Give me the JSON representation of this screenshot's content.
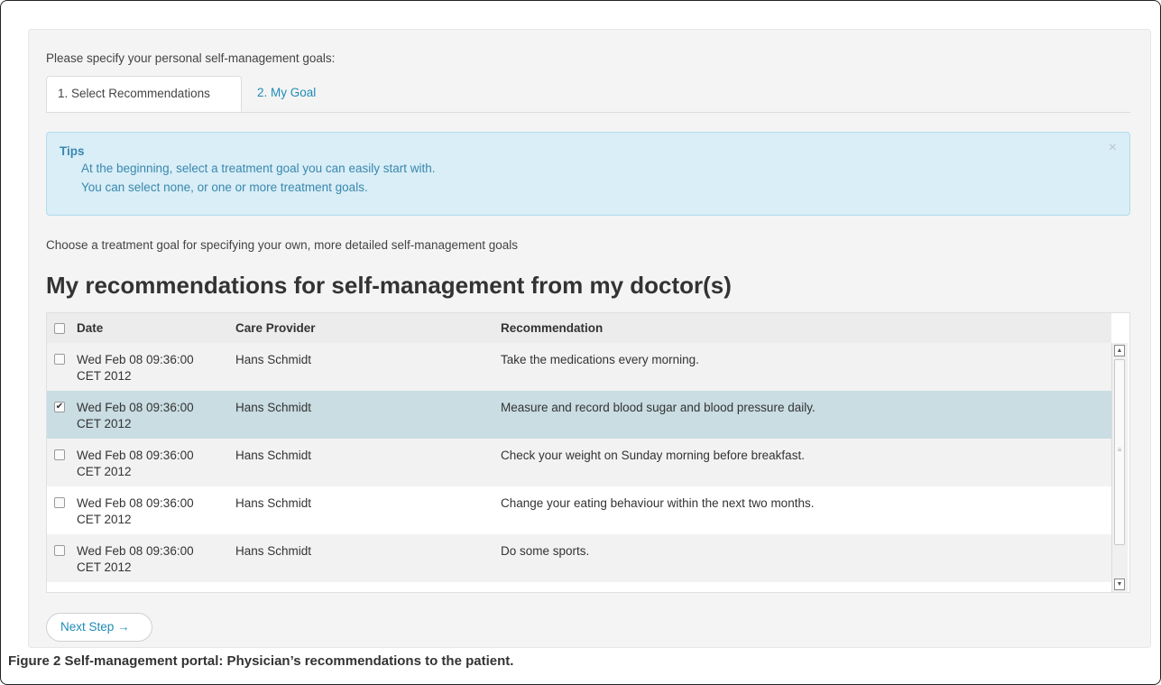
{
  "intro_text": "Please specify your personal self-management goals:",
  "tabs": [
    {
      "label": "1. Select Recommendations",
      "active": true
    },
    {
      "label": "2. My Goal",
      "active": false
    }
  ],
  "tips": {
    "title": "Tips",
    "lines": [
      "At the beginning, select a treatment goal you can easily start with.",
      "You can select none, or one or more treatment goals."
    ],
    "close_glyph": "×"
  },
  "choose_text": "Choose a treatment goal for specifying your own, more detailed self-management goals",
  "heading": "My recommendations for self-management from my doctor(s)",
  "table": {
    "columns": [
      "Date",
      "Care Provider",
      "Recommendation"
    ],
    "rows": [
      {
        "date_line1": "Wed Feb 08 09:36:00",
        "date_line2": "CET 2012",
        "provider": "Hans Schmidt",
        "recommendation": "Take the medications every morning.",
        "checked": false
      },
      {
        "date_line1": "Wed Feb 08 09:36:00",
        "date_line2": "CET 2012",
        "provider": "Hans Schmidt",
        "recommendation": "Measure and record blood sugar and blood pressure daily.",
        "checked": true
      },
      {
        "date_line1": "Wed Feb 08 09:36:00",
        "date_line2": "CET 2012",
        "provider": "Hans Schmidt",
        "recommendation": "Check your weight on Sunday morning before breakfast.",
        "checked": false
      },
      {
        "date_line1": "Wed Feb 08 09:36:00",
        "date_line2": "CET 2012",
        "provider": "Hans Schmidt",
        "recommendation": "Change your eating behaviour within the next two months.",
        "checked": false
      },
      {
        "date_line1": "Wed Feb 08 09:36:00",
        "date_line2": "CET 2012",
        "provider": "Hans Schmidt",
        "recommendation": "Do some sports.",
        "checked": false
      }
    ]
  },
  "next_button": "Next Step →",
  "caption": {
    "label": "Figure 2",
    "text": "Self-management portal: Physician’s recommendations to the patient."
  },
  "colors": {
    "link": "#1f8bb5",
    "tips_bg": "#d9eef7",
    "tips_text": "#3a87ad",
    "selected_row": "#c9dde2",
    "alt_row": "#f2f2f2"
  }
}
